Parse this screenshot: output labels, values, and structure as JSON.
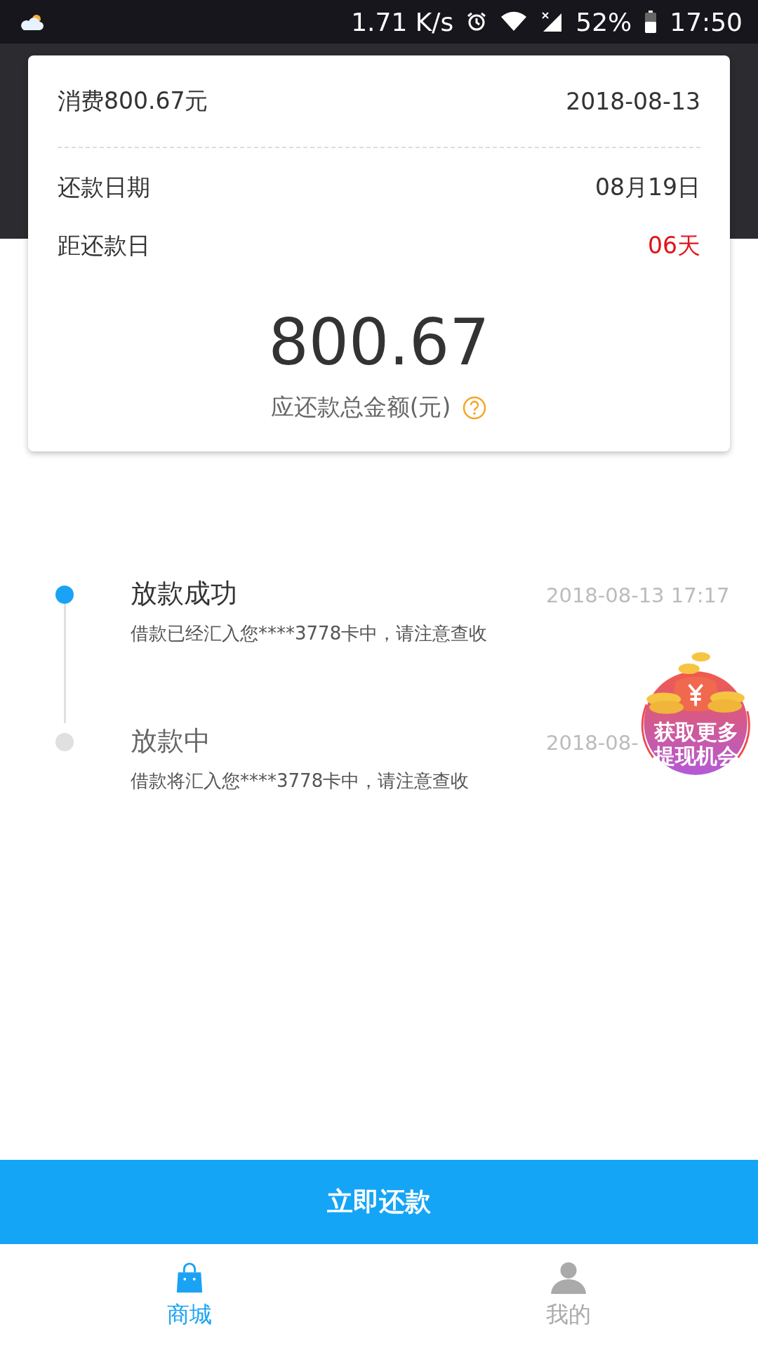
{
  "status_bar": {
    "speed": "1.71 K/s",
    "battery": "52%",
    "time": "17:50"
  },
  "bill": {
    "title": "消费800.67元",
    "date": "2018-08-13",
    "rows": [
      {
        "label": "还款日期",
        "value": "08月19日",
        "highlight": false
      },
      {
        "label": "距还款日",
        "value": "06天",
        "highlight": true
      }
    ],
    "amount": "800.67",
    "amount_label": "应还款总金额(元)"
  },
  "timeline": [
    {
      "title": "放款成功",
      "desc": "借款已经汇入您****3778卡中，请注意查收",
      "time": "2018-08-13 17:17",
      "active": true
    },
    {
      "title": "放款中",
      "desc": "借款将汇入您****3778卡中，请注意查收",
      "time": "2018-08-",
      "active": false
    }
  ],
  "promo_badge": {
    "lines": [
      "获取更多",
      "提现机会"
    ]
  },
  "action_button": "立即还款",
  "nav": [
    {
      "label": "商城",
      "kind": "shop",
      "selected": true
    },
    {
      "label": "我的",
      "kind": "profile",
      "selected": false
    }
  ]
}
